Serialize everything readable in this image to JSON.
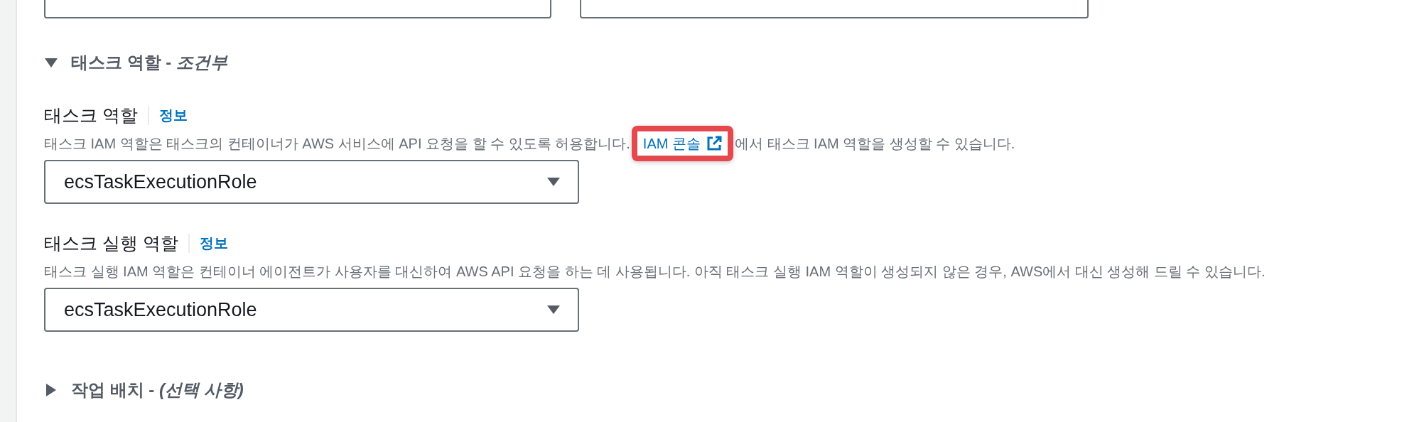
{
  "sections": [
    {
      "heading": "태스크 역할 - *조건부*",
      "expanded": true,
      "fields": [
        {
          "label": "태스크 역할",
          "info": "정보",
          "description": [
            {
              "kind": "text",
              "text": "태스크 IAM 역할은 태스크의 컨테이너가 AWS 서비스에 API 요청을 할 수 있도록 허용합니다."
            },
            {
              "kind": "link",
              "text": "IAM 콘솔",
              "highlighted": true
            },
            {
              "kind": "text",
              "text": "에서 태스크 IAM 역할을 생성할 수 있습니다."
            }
          ],
          "value": "ecsTaskExecutionRole"
        },
        {
          "label": "태스크 실행 역할",
          "info": "정보",
          "description": [
            {
              "kind": "text",
              "text": "태스크 실행 IAM 역할은 컨테이너 에이전트가 사용자를 대신하여 AWS API 요청을 하는 데 사용됩니다. 아직 태스크 실행 IAM 역할이 생성되지 않은 경우, AWS에서 대신 생성해 드릴 수 있습니다."
            }
          ],
          "value": "ecsTaskExecutionRole"
        }
      ]
    },
    {
      "heading": "작업 배치 - *(선택 사항)*",
      "expanded": false
    }
  ]
}
